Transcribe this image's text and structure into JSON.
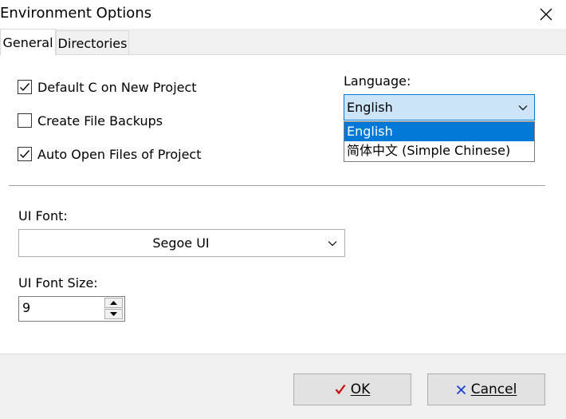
{
  "window": {
    "title": "Environment Options"
  },
  "tabs": [
    {
      "label": "General",
      "active": true
    },
    {
      "label": "Directories",
      "active": false
    }
  ],
  "options": {
    "default_c": {
      "label": "Default C on New Project",
      "checked": true
    },
    "file_backups": {
      "label": "Create File Backups",
      "checked": false
    },
    "auto_open": {
      "label": "Auto Open Files of Project",
      "checked": true
    }
  },
  "language": {
    "label": "Language:",
    "selected": "English",
    "options": [
      "English",
      "简体中文 (Simple Chinese)"
    ]
  },
  "ui_font": {
    "label": "UI Font:",
    "value": "Segoe UI"
  },
  "ui_font_size": {
    "label": "UI Font Size:",
    "value": "9"
  },
  "buttons": {
    "ok": "OK",
    "cancel": "Cancel"
  },
  "colors": {
    "selection": "#0078d7",
    "dropdown_highlight": "#cce4f7",
    "ok_check": "#d00000",
    "cancel_x": "#1a3fd8"
  },
  "icons": {
    "close": "close-icon",
    "checkmark": "checkmark-icon",
    "chevron": "chevron-down-icon",
    "ok": "red-check-icon",
    "cancel": "blue-x-icon"
  }
}
